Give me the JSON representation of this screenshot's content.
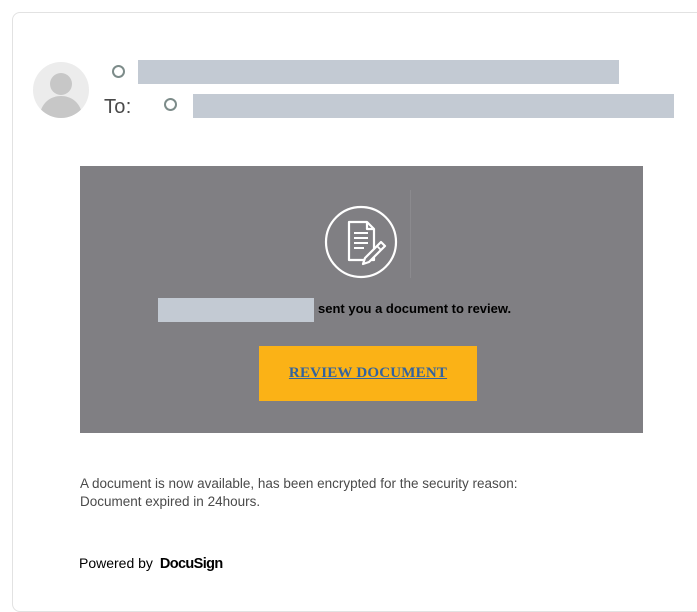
{
  "header": {
    "to_label": "To:"
  },
  "banner": {
    "icon": "document-pen-icon",
    "message": "sent you a document to review.",
    "button_label": "REVIEW DOCUMENT"
  },
  "notice": {
    "line1": "A document is now available, has been encrypted for the security reason:",
    "line2": "Document expired in 24hours."
  },
  "footer": {
    "powered_by": "Powered by",
    "brand": "DocuSign"
  },
  "colors": {
    "banner_bg": "#807f83",
    "button_bg": "#fbb216",
    "button_text": "#33639f",
    "redaction": "#c3cad3"
  }
}
